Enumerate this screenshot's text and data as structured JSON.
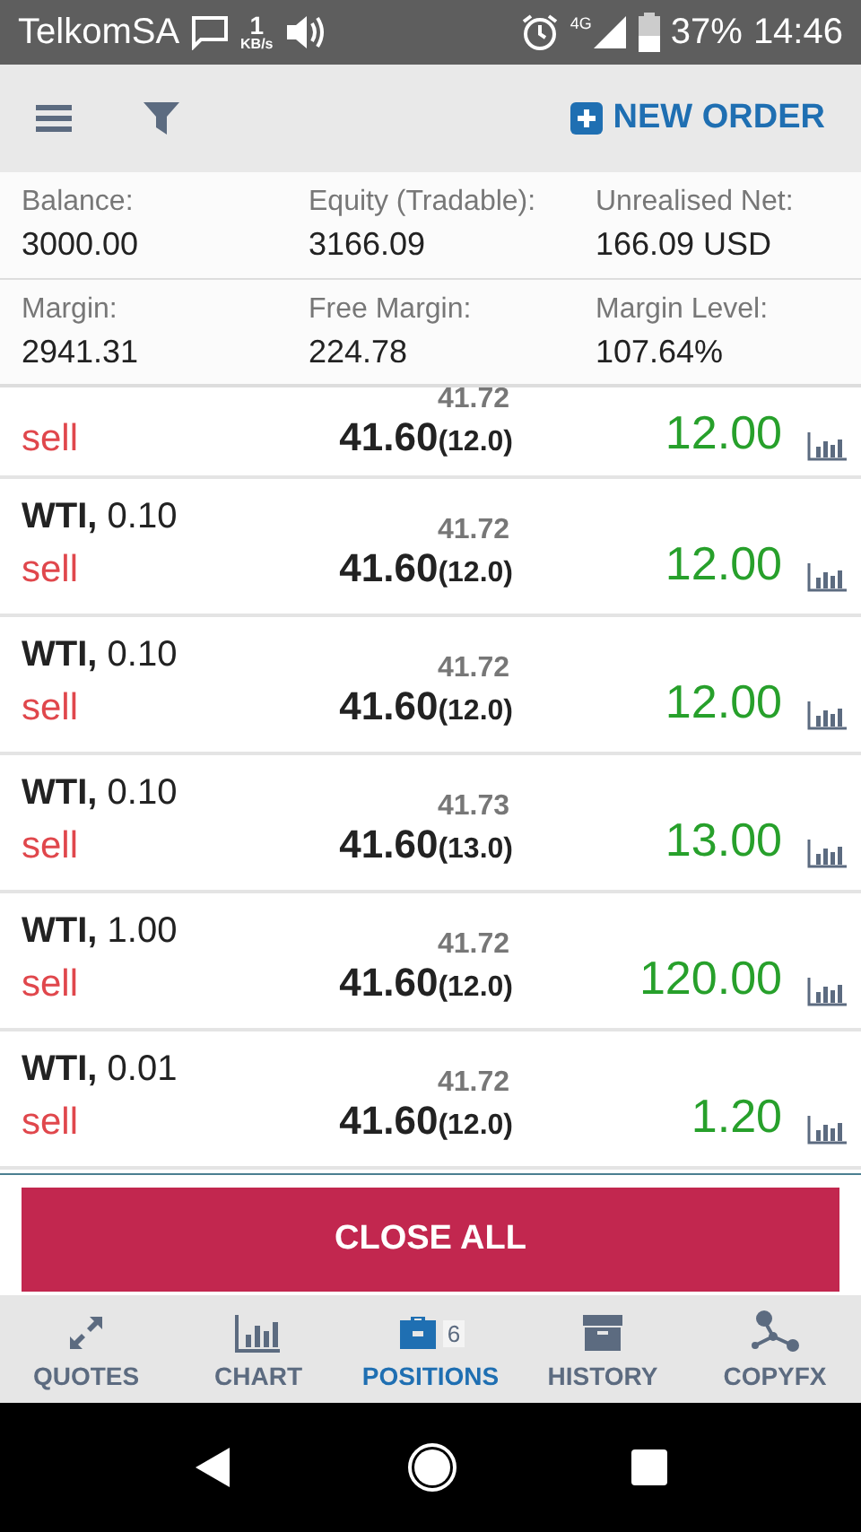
{
  "status_bar": {
    "carrier": "TelkomSA",
    "speed": "1",
    "speed_unit": "KB/s",
    "network": "4G",
    "battery": "37%",
    "time": "14:46"
  },
  "toolbar": {
    "new_order": "NEW ORDER"
  },
  "summary": [
    {
      "label": "Balance:",
      "value": "3000.00"
    },
    {
      "label": "Equity (Tradable):",
      "value": "3166.09"
    },
    {
      "label": "Unrealised Net:",
      "value": "166.09 USD"
    },
    {
      "label": "Margin:",
      "value": "2941.31"
    },
    {
      "label": "Free Margin:",
      "value": "224.78"
    },
    {
      "label": "Margin Level:",
      "value": "107.64%"
    }
  ],
  "positions": [
    {
      "side": "sell",
      "current": "41.72",
      "open": "41.60",
      "pips": "(12.0)",
      "profit": "12.00"
    },
    {
      "symbol": "WTI,",
      "lot": "0.10",
      "side": "sell",
      "current": "41.72",
      "open": "41.60",
      "pips": "(12.0)",
      "profit": "12.00"
    },
    {
      "symbol": "WTI,",
      "lot": "0.10",
      "side": "sell",
      "current": "41.72",
      "open": "41.60",
      "pips": "(12.0)",
      "profit": "12.00"
    },
    {
      "symbol": "WTI,",
      "lot": "0.10",
      "side": "sell",
      "current": "41.73",
      "open": "41.60",
      "pips": "(13.0)",
      "profit": "13.00"
    },
    {
      "symbol": "WTI,",
      "lot": "1.00",
      "side": "sell",
      "current": "41.72",
      "open": "41.60",
      "pips": "(12.0)",
      "profit": "120.00"
    },
    {
      "symbol": "WTI,",
      "lot": "0.01",
      "side": "sell",
      "current": "41.72",
      "open": "41.60",
      "pips": "(12.0)",
      "profit": "1.20"
    }
  ],
  "close_all": "CLOSE ALL",
  "tabs": [
    {
      "kind": "quotes",
      "label": "QUOTES",
      "selected": false
    },
    {
      "kind": "chart",
      "label": "CHART",
      "selected": false
    },
    {
      "kind": "positions",
      "label": "POSITIONS",
      "selected": true,
      "badge": "6"
    },
    {
      "kind": "history",
      "label": "HISTORY",
      "selected": false
    },
    {
      "kind": "copyfx",
      "label": "COPYFX",
      "selected": false
    }
  ]
}
